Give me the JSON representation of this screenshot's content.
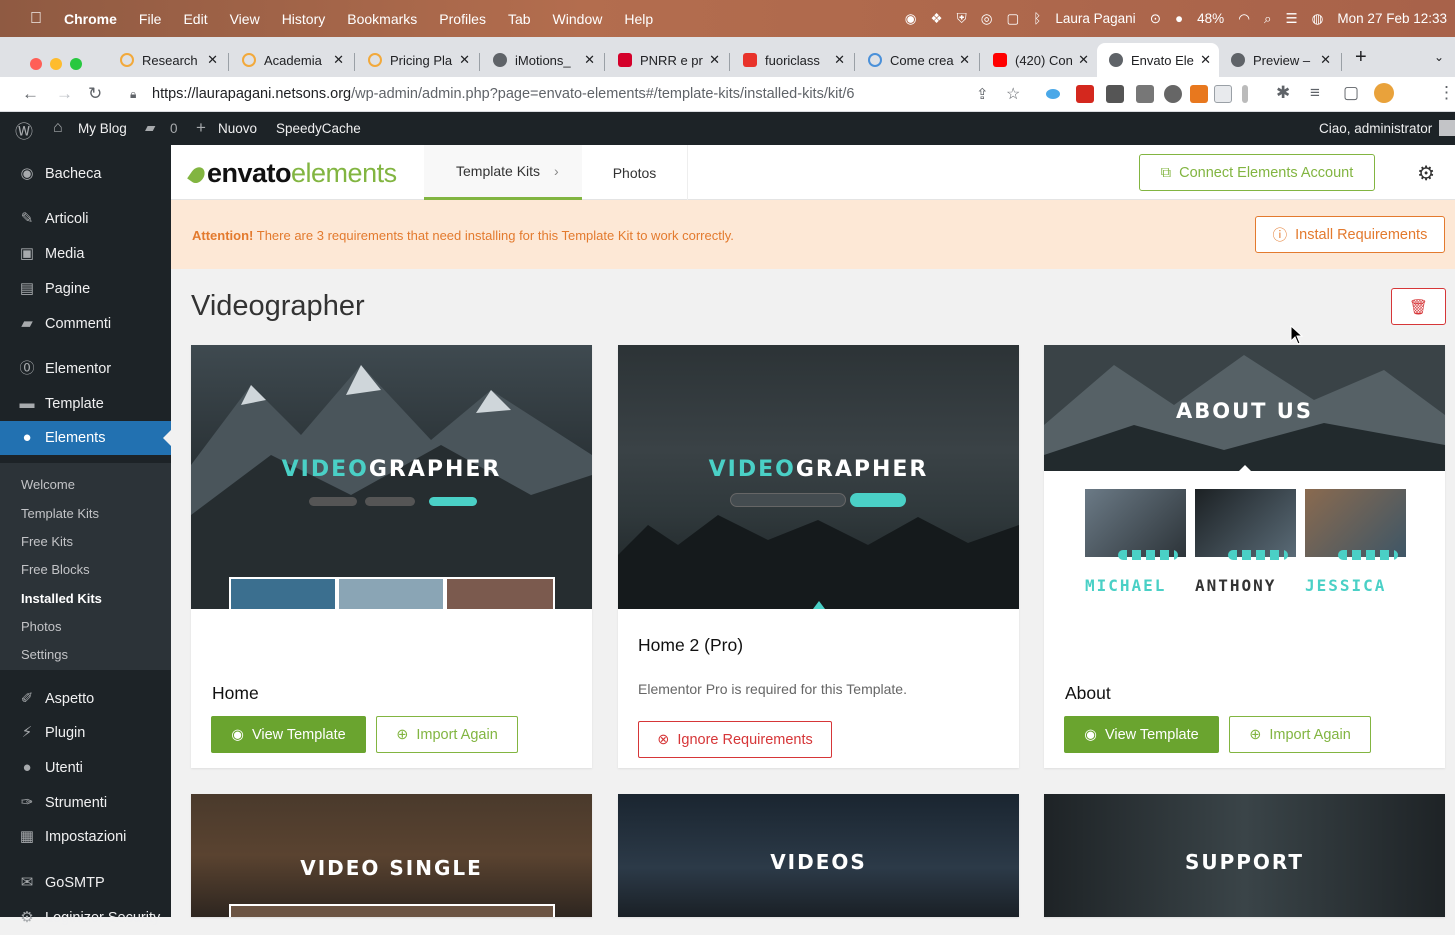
{
  "menubar": {
    "apple": "",
    "app": "Chrome",
    "items": [
      "File",
      "Edit",
      "View",
      "History",
      "Bookmarks",
      "Profiles",
      "Tab",
      "Window",
      "Help"
    ],
    "user": "Laura Pagani",
    "battery": "48%",
    "datetime": "Mon 27 Feb  12:33"
  },
  "tabs": [
    {
      "label": "Research",
      "active": false
    },
    {
      "label": "Academia",
      "active": false
    },
    {
      "label": "Pricing Pla",
      "active": false
    },
    {
      "label": "iMotions_",
      "active": false
    },
    {
      "label": "PNRR e pr",
      "active": false
    },
    {
      "label": "fuoriclass",
      "active": false
    },
    {
      "label": "Come crea",
      "active": false
    },
    {
      "label": "(420) Con",
      "active": false
    },
    {
      "label": "Envato Ele",
      "active": true
    },
    {
      "label": "Preview –",
      "active": false
    }
  ],
  "address": {
    "url_host": "https://laurapagani.netsons.org",
    "url_path": "/wp-admin/admin.php?page=envato-elements#/template-kits/installed-kits/kit/6"
  },
  "wpbar": {
    "site": "My Blog",
    "comments": "0",
    "new": "Nuovo",
    "plugin": "SpeedyCache",
    "greeting": "Ciao, administrator"
  },
  "sidebar": {
    "items": [
      {
        "label": "Bacheca"
      },
      {
        "label": "Articoli"
      },
      {
        "label": "Media"
      },
      {
        "label": "Pagine"
      },
      {
        "label": "Commenti"
      },
      {
        "label": "Elementor"
      },
      {
        "label": "Template"
      },
      {
        "label": "Elements"
      },
      {
        "label": "Aspetto"
      },
      {
        "label": "Plugin"
      },
      {
        "label": "Utenti"
      },
      {
        "label": "Strumenti"
      },
      {
        "label": "Impostazioni"
      },
      {
        "label": "GoSMTP"
      },
      {
        "label": "Loginizer Security"
      }
    ],
    "submenu": [
      "Welcome",
      "Template Kits",
      "Free Kits",
      "Free Blocks",
      "Installed Kits",
      "Photos",
      "Settings"
    ]
  },
  "envato": {
    "logo_a": "envato",
    "logo_b": "elements",
    "tab_kits": "Template Kits",
    "tab_photos": "Photos",
    "connect": "Connect Elements Account",
    "notice_bold": "Attention!",
    "notice_text": " There are 3 requirements that need installing for this Template Kit to work correctly.",
    "install_req": "Install Requirements",
    "kit_title": "Videographer"
  },
  "cards": [
    {
      "title": "Home",
      "hero": "VIDEOGRAPHER",
      "btn1": "View Template",
      "btn2": "Import Again"
    },
    {
      "title": "Home 2 (Pro)",
      "hero": "VIDEOGRAPHER",
      "desc": "Elementor Pro is required for this Template.",
      "btn1": "Ignore Requirements"
    },
    {
      "title": "About",
      "hero": "ABOUT US",
      "names": [
        "MICHAEL",
        "ANTHONY",
        "JESSICA"
      ],
      "btn1": "View Template",
      "btn2": "Import Again"
    },
    {
      "hero": "VIDEO SINGLE"
    },
    {
      "hero": "VIDEOS"
    },
    {
      "hero": "SUPPORT"
    }
  ]
}
